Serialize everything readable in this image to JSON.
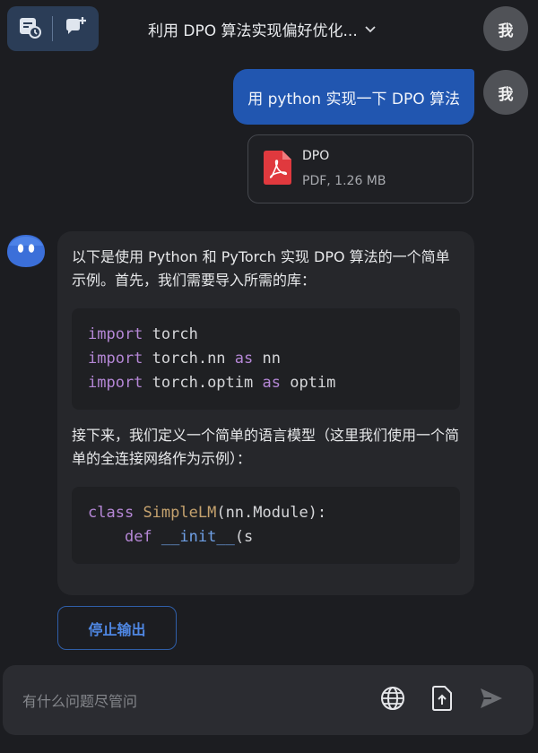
{
  "header": {
    "title": "利用 DPO 算法实现偏好优化...",
    "avatar_label": "我"
  },
  "user_message": {
    "avatar_label": "我",
    "text": "用 python 实现一下 DPO 算法",
    "attachment": {
      "name": "DPO",
      "meta": "PDF, 1.26 MB"
    }
  },
  "bot_message": {
    "intro": "以下是使用 Python 和 PyTorch 实现 DPO 算法的一个简单示例。首先，我们需要导入所需的库：",
    "code1": [
      {
        "kw": "import",
        "rest1": " torch",
        "kw2": "",
        "rest2": ""
      },
      {
        "kw": "import",
        "rest1": " torch.nn ",
        "kw2": "as",
        "rest2": " nn"
      },
      {
        "kw": "import",
        "rest1": " torch.optim ",
        "kw2": "as",
        "rest2": " optim"
      }
    ],
    "middle": "接下来，我们定义一个简单的语言模型（这里我们使用一个简单的全连接网络作为示例）：",
    "code2": {
      "line1_kw": "class",
      "line1_cls": "SimpleLM",
      "line1_rest": "(nn.Module):",
      "line2_indent": "    ",
      "line2_kw": "def",
      "line2_fn": "__init__",
      "line2_rest": "(s"
    }
  },
  "stop_button": "停止输出",
  "input": {
    "placeholder": "有什么问题尽管问"
  },
  "colors": {
    "accent": "#2156b0",
    "stop_text": "#4f87e3",
    "keyword": "#b587d6"
  }
}
